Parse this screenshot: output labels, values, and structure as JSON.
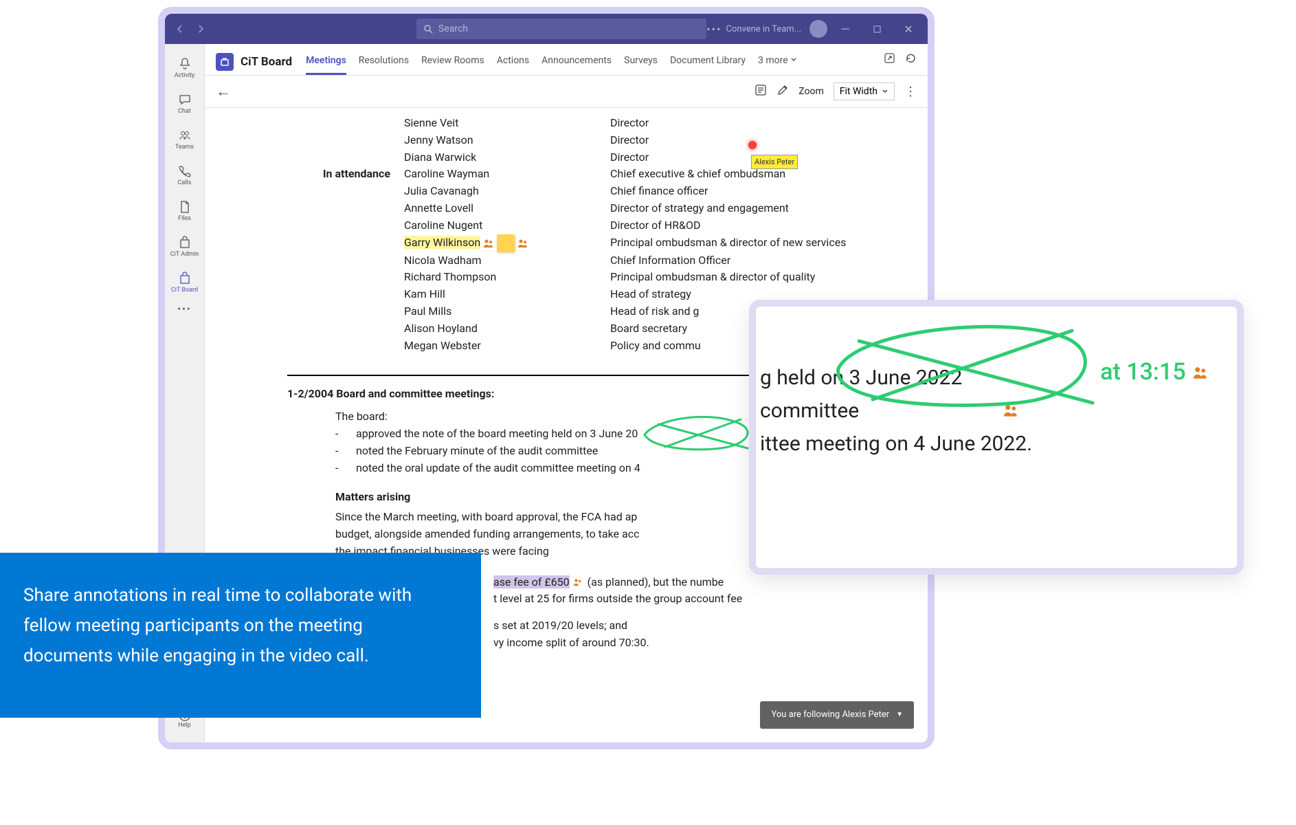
{
  "titlebar": {
    "search_placeholder": "Search",
    "app_label": "Convene in Team..."
  },
  "left_rail": {
    "items": [
      "Activity",
      "Chat",
      "Teams",
      "Calls",
      "Files",
      "CiT Admin",
      "CiT Board"
    ],
    "help": "Help"
  },
  "app_header": {
    "title": "CiT Board",
    "tabs": [
      "Meetings",
      "Resolutions",
      "Review Rooms",
      "Actions",
      "Announcements",
      "Surveys",
      "Document Library",
      "3 more"
    ]
  },
  "toolbar": {
    "zoom_label": "Zoom",
    "zoom_value": "Fit Width"
  },
  "doc": {
    "attendees_label": "In attendance",
    "names_top": [
      {
        "n": "Sienne Veit",
        "r": "Director"
      },
      {
        "n": "Jenny Watson",
        "r": "Director"
      },
      {
        "n": "Diana Warwick",
        "r": "Director"
      }
    ],
    "attendees": [
      {
        "n": "Caroline Wayman",
        "r": "Chief executive & chief ombudsman"
      },
      {
        "n": "Julia Cavanagh",
        "r": "Chief finance officer"
      },
      {
        "n": "Annette Lovell",
        "r": "Director of strategy and engagement"
      },
      {
        "n": "Caroline Nugent",
        "r": "Director of HR&OD"
      },
      {
        "n": "Garry Wilkinson",
        "r": "Principal ombudsman & director of new services"
      },
      {
        "n": "Nicola Wadham",
        "r": "Chief Information Officer"
      },
      {
        "n": "Richard Thompson",
        "r": "Principal ombudsman & director of quality"
      },
      {
        "n": "Kam Hill",
        "r": "Head of strategy"
      },
      {
        "n": "Paul Mills",
        "r": "Head of risk and g"
      },
      {
        "n": "Alison Hoyland",
        "r": "Board secretary"
      },
      {
        "n": "Megan Webster",
        "r": "Policy and commu"
      }
    ],
    "section_title": "1-2/2004 Board and committee meetings:",
    "board_label": "The board:",
    "bullets": [
      "approved the note of the board meeting held on 3 June 20",
      "noted the February minute of the audit committee",
      "noted the oral update of the audit committee meeting on 4"
    ],
    "matters_title": "Matters arising",
    "matters_para": "Since the March meeting, with board approval, the FCA had ap\nbudget, alongside amended funding arrangements, to take acc\n                       the impact financial businesses were facing",
    "fee_frag_1": "ase fee of £650",
    "fee_frag_2": " (as planned), but the numbe",
    "fee_frag_3": "t level at 25 for firms outside the group account fee",
    "levels_line": "s set at 2019/20 levels; and",
    "split_line": "vy income split of around 70:30.",
    "cursor_tooltip": "Alexis Peter",
    "follow_text": "You are following Alexis Peter"
  },
  "zoom_panel": {
    "time": "at 13:15",
    "line1": "g held on 3 June 2022",
    "line2": "committee",
    "line3": "ittee meeting on 4 June 2022."
  },
  "callout": {
    "text": "Share annotations in real time to collaborate with fellow meeting participants on the meeting documents while engaging in the video call."
  }
}
